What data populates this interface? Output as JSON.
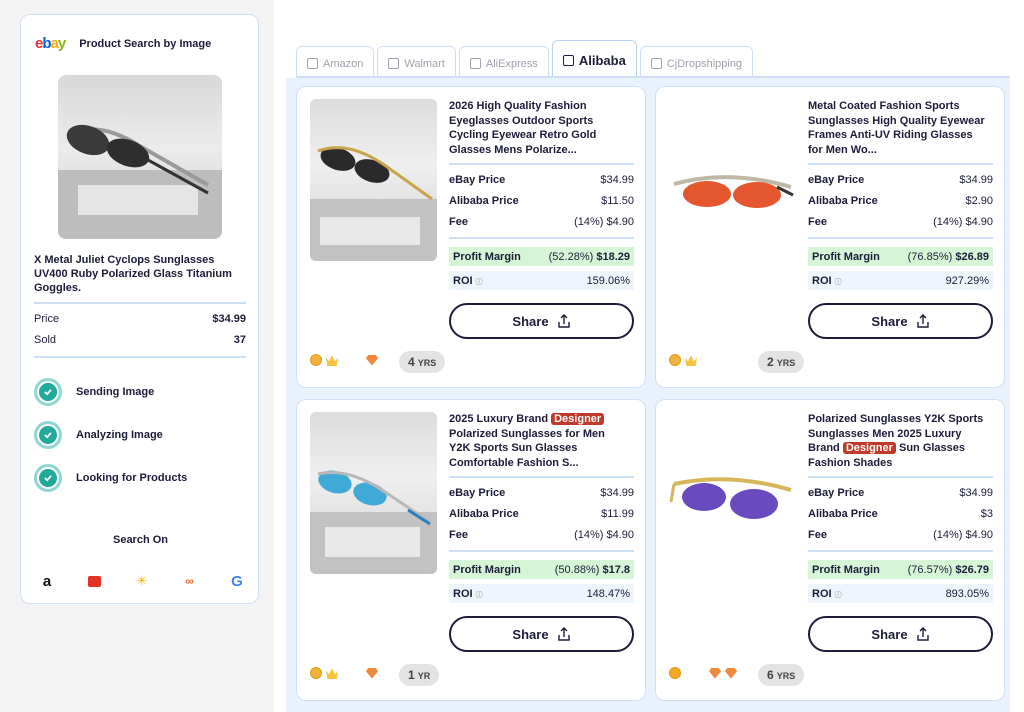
{
  "sidebar": {
    "logo_text": "ebay",
    "title": "Product Search by Image",
    "product_title": "X Metal Juliet Cyclops Sunglasses UV400 Ruby Polarized Glass Titanium Goggles.",
    "price_label": "Price",
    "price_value": "$34.99",
    "sold_label": "Sold",
    "sold_value": "37",
    "steps": [
      {
        "label": "Sending Image",
        "status": "done"
      },
      {
        "label": "Analyzing Image",
        "status": "done"
      },
      {
        "label": "Looking for Products",
        "status": "done"
      }
    ],
    "search_on_label": "Search On",
    "stores": [
      "amazon-icon",
      "aliexpress-icon",
      "walmart-icon",
      "cjdropshipping-icon",
      "google-icon"
    ]
  },
  "tabs": [
    {
      "label": "Amazon",
      "active": false
    },
    {
      "label": "Walmart",
      "active": false
    },
    {
      "label": "AliExpress",
      "active": false
    },
    {
      "label": "Alibaba",
      "active": true
    },
    {
      "label": "CjDropshipping",
      "active": false
    }
  ],
  "cards": [
    {
      "title": "2026 High Quality Fashion Eyeglasses Outdoor Sports Cycling Eyewear Retro Gold Glasses Mens Polarize...",
      "ebay_price_label": "eBay Price",
      "ebay_price": "$34.99",
      "source_price_label": "Alibaba Price",
      "source_price": "$11.50",
      "fee_label": "Fee",
      "fee_pct": "(14%)",
      "fee": "$4.90",
      "profit_label": "Profit Margin",
      "profit_pct": "(52.28%)",
      "profit": "$18.29",
      "roi_label": "ROI",
      "roi": "159.06%",
      "share_label": "Share",
      "years_num": "4",
      "years_unit": "YRS",
      "lens_color": "#2a2a2a",
      "frame_color": "#c9a44a"
    },
    {
      "title": "Metal Coated Fashion Sports Sunglasses High Quality Eyewear Frames Anti-UV Riding Glasses for Men Wo...",
      "ebay_price_label": "eBay Price",
      "ebay_price": "$34.99",
      "source_price_label": "Alibaba Price",
      "source_price": "$2.90",
      "fee_label": "Fee",
      "fee_pct": "(14%)",
      "fee": "$4.90",
      "profit_label": "Profit Margin",
      "profit_pct": "(76.85%)",
      "profit": "$26.89",
      "roi_label": "ROI",
      "roi": "927.29%",
      "share_label": "Share",
      "years_num": "2",
      "years_unit": "YRS",
      "lens_color": "#e4572e",
      "frame_color": "#bfb8a6"
    },
    {
      "title_prefix": "2025 Luxury Brand",
      "title_badge": "Designer",
      "title_suffix": "Polarized Sunglasses for Men Y2K Sports Sun Glasses Comfortable Fashion S...",
      "ebay_price_label": "eBay Price",
      "ebay_price": "$34.99",
      "source_price_label": "Alibaba Price",
      "source_price": "$11.99",
      "fee_label": "Fee",
      "fee_pct": "(14%)",
      "fee": "$4.90",
      "profit_label": "Profit Margin",
      "profit_pct": "(50.88%)",
      "profit": "$17.8",
      "roi_label": "ROI",
      "roi": "148.47%",
      "share_label": "Share",
      "years_num": "1",
      "years_unit": "YR",
      "lens_color": "#3fa9d8",
      "frame_color": "#b8b8b8"
    },
    {
      "title_prefix": "Polarized Sunglasses Y2K Sports Sunglasses Men 2025 Luxury Brand",
      "title_badge": "Designer",
      "title_suffix": "Sun Glasses Fashion Shades",
      "ebay_price_label": "eBay Price",
      "ebay_price": "$34.99",
      "source_price_label": "Alibaba Price",
      "source_price": "$3",
      "fee_label": "Fee",
      "fee_pct": "(14%)",
      "fee": "$4.90",
      "profit_label": "Profit Margin",
      "profit_pct": "(76.57%)",
      "profit": "$26.79",
      "roi_label": "ROI",
      "roi": "893.05%",
      "share_label": "Share",
      "years_num": "6",
      "years_unit": "YRS",
      "lens_color": "#6a4bbf",
      "frame_color": "#d6b65a"
    }
  ],
  "colors": {
    "accent": "#cfe0f4",
    "profit_bg": "#d6f5d6",
    "designer_badge": "#c0392b",
    "check": "#22a99b"
  }
}
